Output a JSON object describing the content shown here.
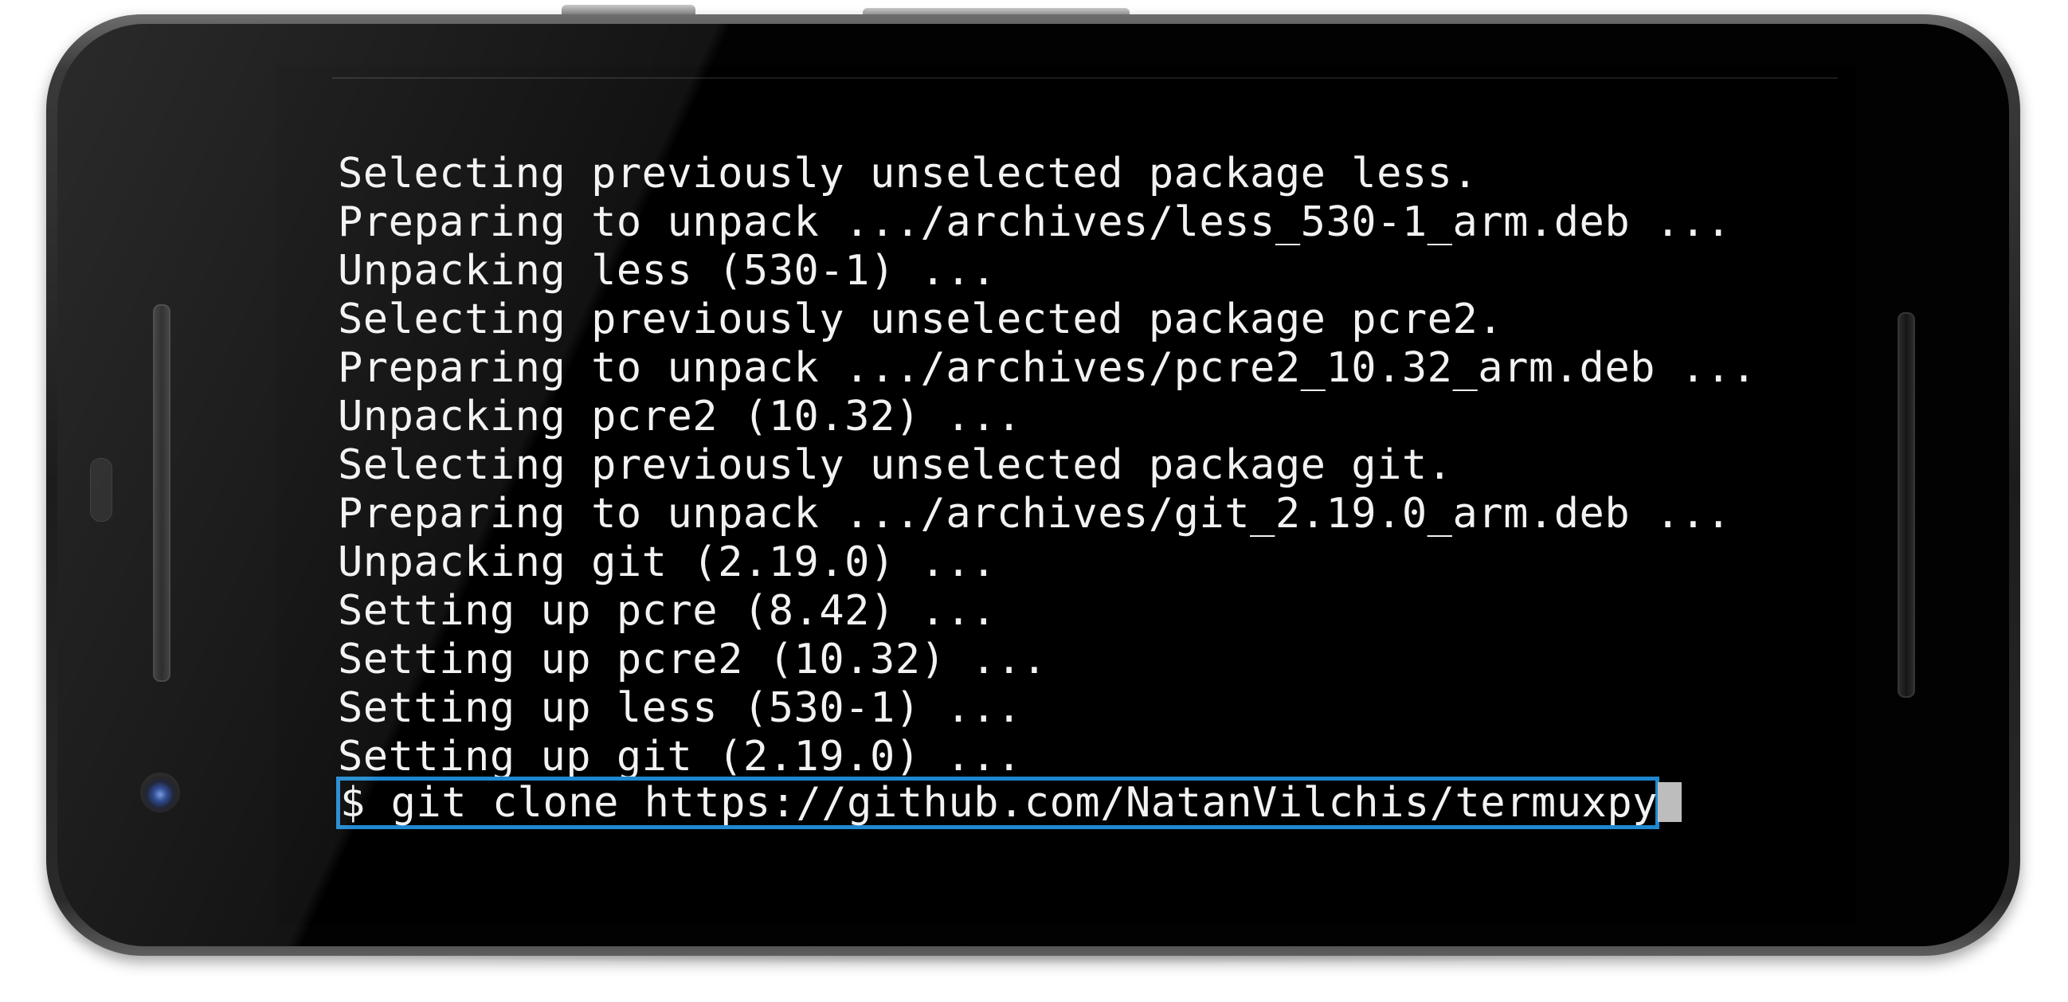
{
  "terminal": {
    "output_lines": [
      "Selecting previously unselected package less.",
      "Preparing to unpack .../archives/less_530-1_arm.deb ...",
      "Unpacking less (530-1) ...",
      "Selecting previously unselected package pcre2.",
      "Preparing to unpack .../archives/pcre2_10.32_arm.deb ...",
      "Unpacking pcre2 (10.32) ...",
      "Selecting previously unselected package git.",
      "Preparing to unpack .../archives/git_2.19.0_arm.deb ...",
      "Unpacking git (2.19.0) ...",
      "Setting up pcre (8.42) ...",
      "Setting up pcre2 (10.32) ...",
      "Setting up less (530-1) ...",
      "Setting up git (2.19.0) ..."
    ],
    "prompt": "$ git clone https://github.com/NatanVilchis/termuxpy",
    "highlight_color": "#1e88d0",
    "text_color": "#f2f2f2",
    "background_color": "#000000"
  }
}
